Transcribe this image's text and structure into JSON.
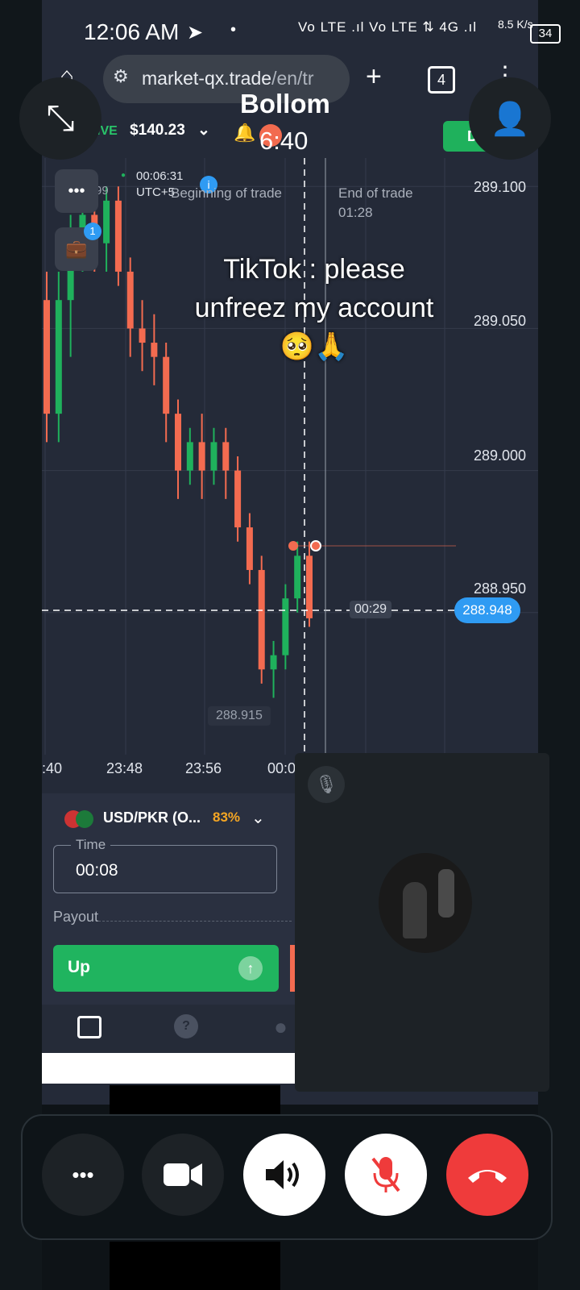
{
  "status_bar": {
    "time": "12:06 AM",
    "network_icons": "Vo LTE .ıl Vo LTE ⇅ 4G .ıl",
    "speed": "8.5 K/s",
    "battery": "34"
  },
  "browser": {
    "url_host": "market-qx.trade",
    "url_path": "/en/tr",
    "tab_count": "4"
  },
  "call": {
    "caller_name": "Bollom",
    "duration": "6:40"
  },
  "trading": {
    "account_mode": "IVE",
    "balance": "$140.23",
    "deposit_label": "Dep",
    "trade_timer": "00:06:31",
    "timezone": "UTC+5",
    "partial_label": "99",
    "begin_label": "Beginning of trade",
    "end_label": "End of trade",
    "end_time": "01:28",
    "countdown": "00:29",
    "current_price": "288.948",
    "low_label": "288.915",
    "overlay_text_line1": "TikTok : please",
    "overlay_text_line2": "unfreez my account",
    "overlay_emoji": "🥺🙏",
    "portfolio_badge": "1",
    "pair": "USD/PKR (O...",
    "payout_pct": "83%",
    "time_label": "Time",
    "time_value": "00:08",
    "payout_label": "Payout",
    "up_label": "Up"
  },
  "chart_data": {
    "type": "candlestick",
    "y_ticks": [
      "289.100",
      "289.050",
      "289.000",
      "288.950"
    ],
    "x_ticks": [
      ":40",
      "23:48",
      "23:56",
      "00:0"
    ],
    "ylim": [
      288.9,
      289.11
    ],
    "candles": [
      {
        "o": 289.06,
        "c": 289.02,
        "h": 289.07,
        "l": 289.01
      },
      {
        "o": 289.02,
        "c": 289.06,
        "h": 289.07,
        "l": 289.01
      },
      {
        "o": 289.06,
        "c": 289.08,
        "h": 289.09,
        "l": 289.04
      },
      {
        "o": 289.08,
        "c": 289.09,
        "h": 289.1,
        "l": 289.07
      },
      {
        "o": 289.09,
        "c": 289.08,
        "h": 289.1,
        "l": 289.07
      },
      {
        "o": 289.08,
        "c": 289.095,
        "h": 289.1,
        "l": 289.07
      },
      {
        "o": 289.095,
        "c": 289.07,
        "h": 289.1,
        "l": 289.065
      },
      {
        "o": 289.07,
        "c": 289.05,
        "h": 289.075,
        "l": 289.04
      },
      {
        "o": 289.05,
        "c": 289.045,
        "h": 289.06,
        "l": 289.035
      },
      {
        "o": 289.045,
        "c": 289.04,
        "h": 289.055,
        "l": 289.03
      },
      {
        "o": 289.04,
        "c": 289.02,
        "h": 289.045,
        "l": 289.01
      },
      {
        "o": 289.02,
        "c": 289.0,
        "h": 289.025,
        "l": 288.99
      },
      {
        "o": 289.0,
        "c": 289.01,
        "h": 289.015,
        "l": 288.995
      },
      {
        "o": 289.01,
        "c": 289.0,
        "h": 289.02,
        "l": 288.99
      },
      {
        "o": 289.0,
        "c": 289.01,
        "h": 289.015,
        "l": 288.995
      },
      {
        "o": 289.01,
        "c": 289.0,
        "h": 289.015,
        "l": 288.99
      },
      {
        "o": 289.0,
        "c": 288.98,
        "h": 289.005,
        "l": 288.975
      },
      {
        "o": 288.98,
        "c": 288.965,
        "h": 288.985,
        "l": 288.96
      },
      {
        "o": 288.965,
        "c": 288.93,
        "h": 288.97,
        "l": 288.925
      },
      {
        "o": 288.93,
        "c": 288.935,
        "h": 288.94,
        "l": 288.92
      },
      {
        "o": 288.935,
        "c": 288.955,
        "h": 288.96,
        "l": 288.93
      },
      {
        "o": 288.955,
        "c": 288.97,
        "h": 288.975,
        "l": 288.95
      },
      {
        "o": 288.97,
        "c": 288.948,
        "h": 288.975,
        "l": 288.945
      }
    ],
    "current": 288.948,
    "colors": {
      "up": "#1fb15c",
      "down": "#f36b50",
      "current": "#2f9bf3"
    }
  },
  "controls": {
    "more": "more-icon",
    "video": "video-icon",
    "speaker": "speaker-icon",
    "mute": "mic-off-icon",
    "end_call": "end-call-icon"
  }
}
